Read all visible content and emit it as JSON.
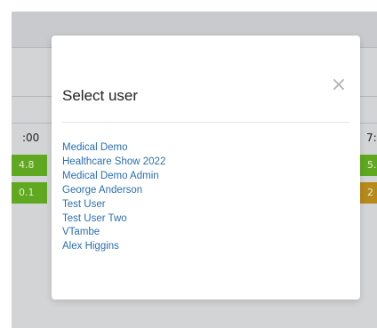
{
  "background": {
    "left_time": ":00",
    "right_time": "7:0",
    "rows": [
      {
        "left": "4.8",
        "right": "5.",
        "left_color": "#5fa81f",
        "right_color": "#5fa81f"
      },
      {
        "left": "0.1",
        "right": "2",
        "left_color": "#5fa81f",
        "right_color": "#b78a1a"
      }
    ]
  },
  "modal": {
    "title": "Select user",
    "close_glyph": "×",
    "users": [
      "Medical Demo",
      "Healthcare Show 2022",
      "Medical Demo Admin",
      "George Anderson",
      "Test User",
      "Test User Two",
      "VTambe",
      "Alex Higgins"
    ]
  },
  "colors": {
    "overlay": "#d3d4d6",
    "link": "#2a6fb0",
    "title": "#222222"
  }
}
